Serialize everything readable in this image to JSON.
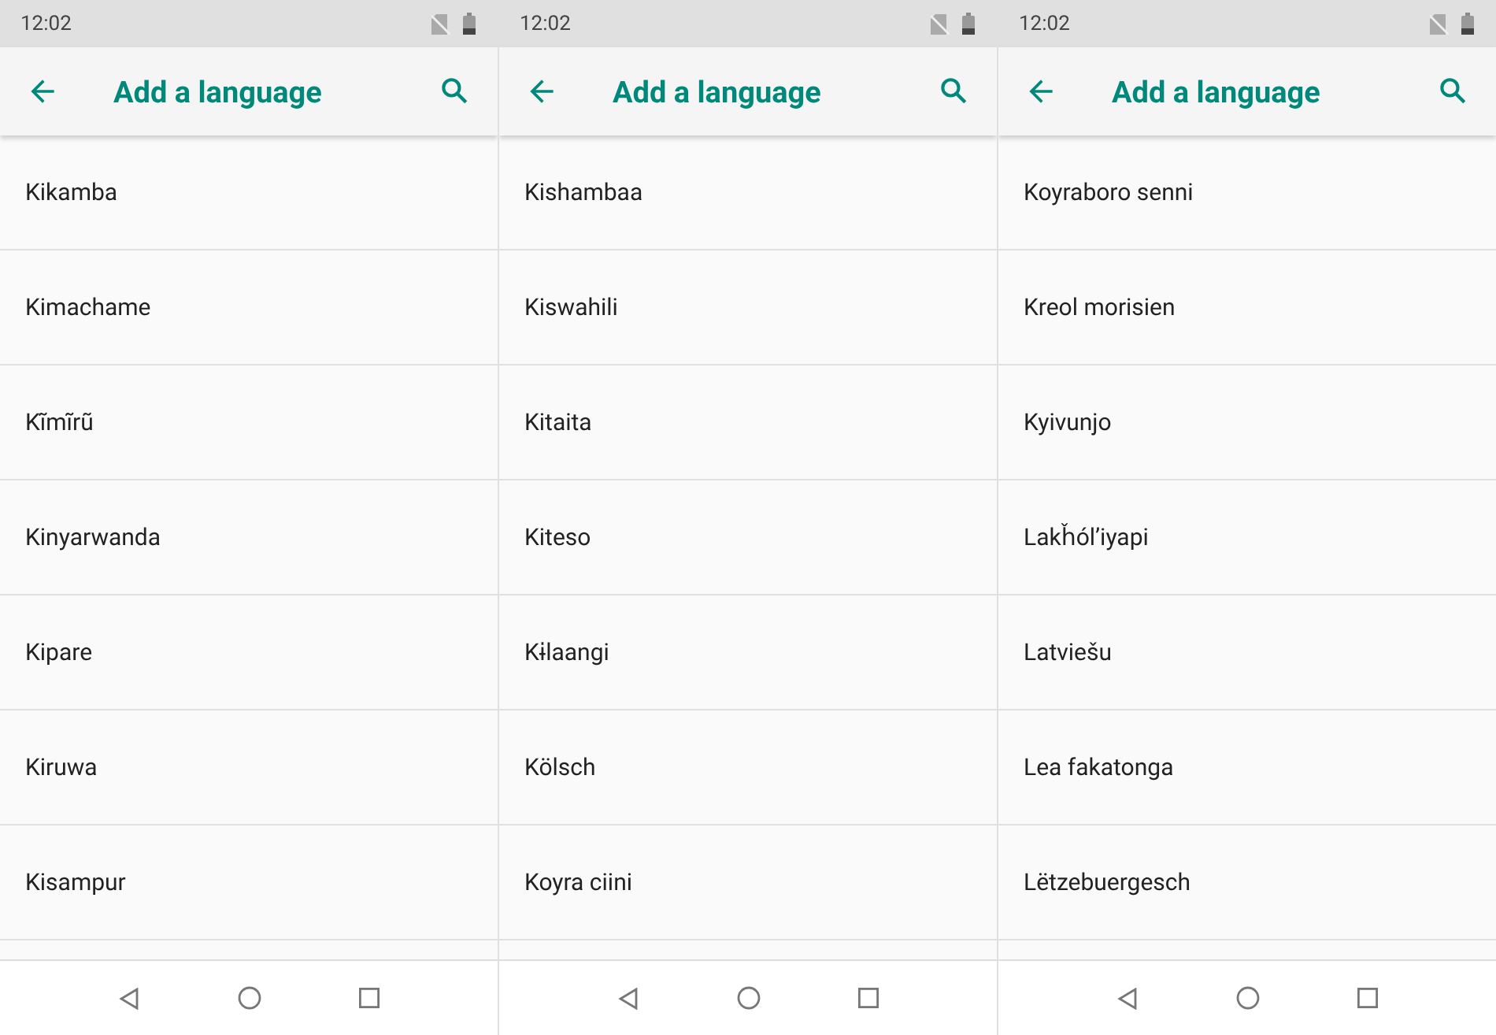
{
  "screens": [
    {
      "status_bar": {
        "time": "12:02"
      },
      "app_bar": {
        "title": "Add a language"
      },
      "languages": [
        "Kikamba",
        "Kimachame",
        "Kĩmĩrũ",
        "Kinyarwanda",
        "Kipare",
        "Kiruwa",
        "Kisampur"
      ]
    },
    {
      "status_bar": {
        "time": "12:02"
      },
      "app_bar": {
        "title": "Add a language"
      },
      "languages": [
        "Kishambaa",
        "Kiswahili",
        "Kitaita",
        "Kiteso",
        "Kɨlaangi",
        "Kölsch",
        "Koyra ciini"
      ]
    },
    {
      "status_bar": {
        "time": "12:02"
      },
      "app_bar": {
        "title": "Add a language"
      },
      "languages": [
        "Koyraboro senni",
        "Kreol morisien",
        "Kyivunjo",
        "Lakȟól’iyapi",
        "Latviešu",
        "Lea fakatonga",
        "Lëtzebuergesch"
      ]
    }
  ]
}
